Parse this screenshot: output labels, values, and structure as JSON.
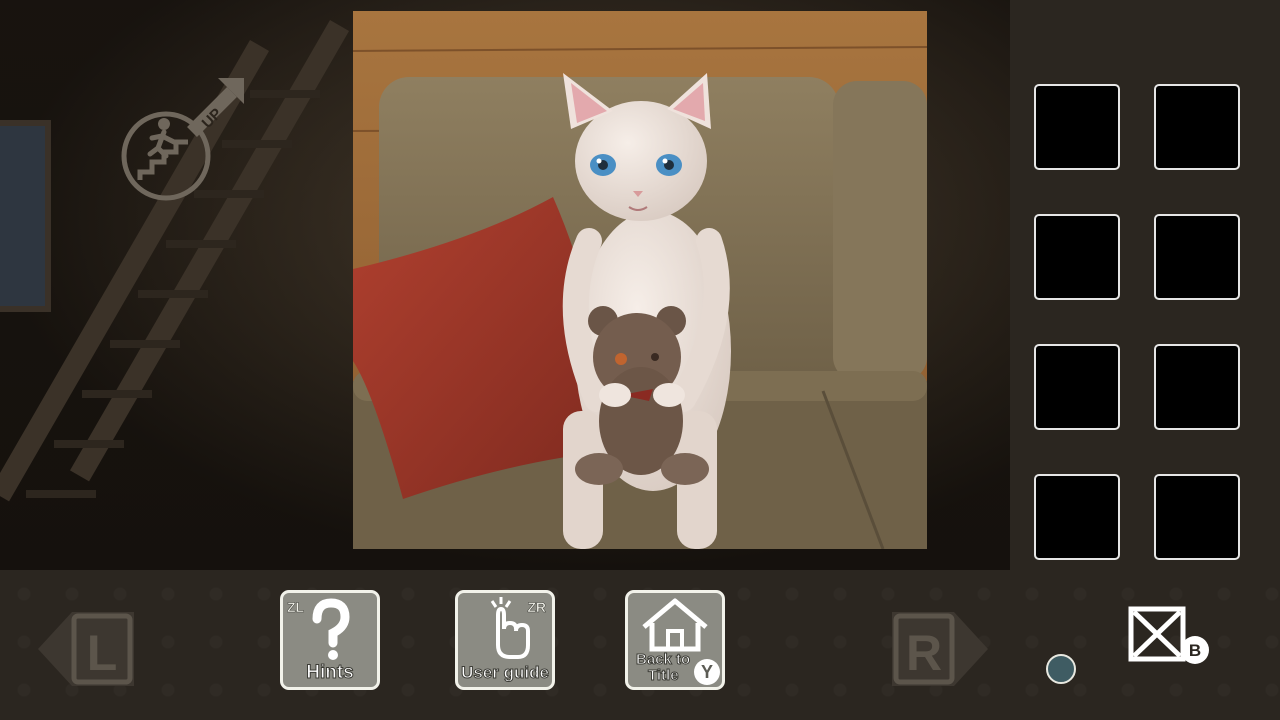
{
  "scene": {
    "up_label": "UP"
  },
  "inventory": {
    "slots": [
      "",
      "",
      "",
      "",
      "",
      "",
      "",
      ""
    ]
  },
  "toolbar": {
    "left_label": "L",
    "right_label": "R",
    "hints": {
      "label": "Hints",
      "shortcut": "ZL"
    },
    "guide": {
      "label": "User guide",
      "shortcut": "ZR"
    },
    "title": {
      "label_line1": "Back to",
      "label_line2": "Title",
      "shortcut": "Y"
    },
    "close_shortcut": "B"
  },
  "colors": {
    "button_fill": "#8b8b83",
    "button_border": "#f2f2ea",
    "page_dot": "#3f5c63",
    "slot_fill": "#000000"
  }
}
